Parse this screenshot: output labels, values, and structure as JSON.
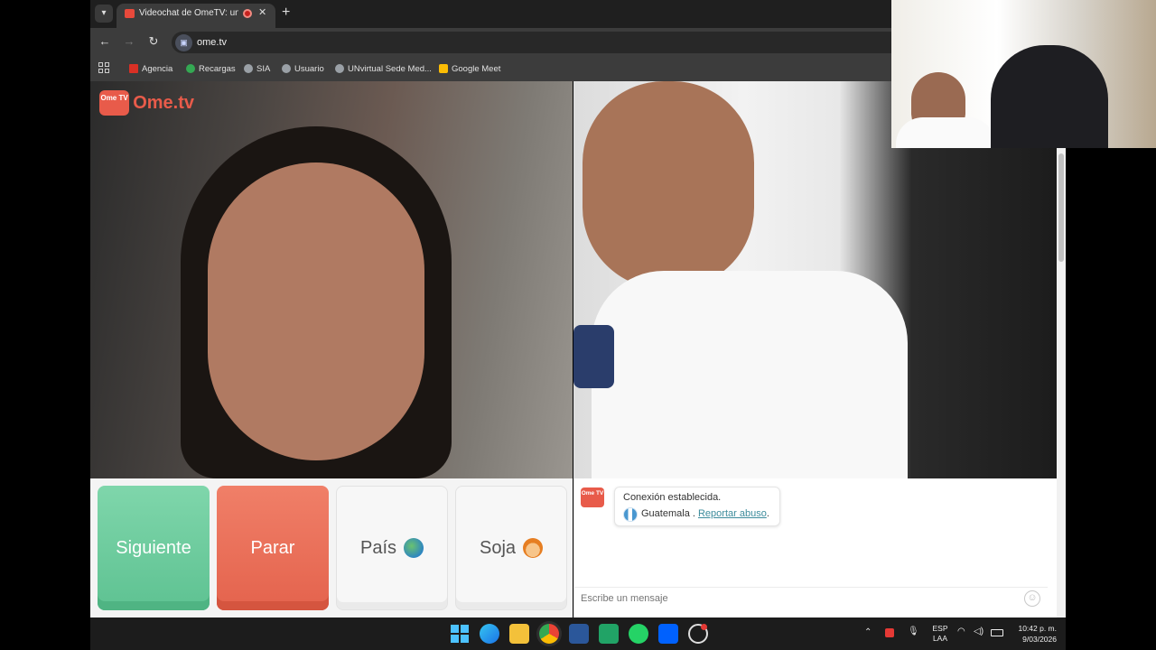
{
  "browser": {
    "tab_title": "Videochat de OmeTV: una ",
    "url": "ome.tv",
    "tab_close": "✕",
    "new_tab": "+",
    "bookmarks": [
      {
        "label": "Agencia",
        "icon": "gmail-icon",
        "color": "#d93025"
      },
      {
        "label": "Recargas",
        "icon": "recargas-icon",
        "color": "#34a853"
      },
      {
        "label": "SIA",
        "icon": "globe-icon",
        "color": "#9aa0a6"
      },
      {
        "label": "Usuario",
        "icon": "globe-icon",
        "color": "#9aa0a6"
      },
      {
        "label": "UNvirtual Sede Med...",
        "icon": "globe-icon",
        "color": "#9aa0a6"
      },
      {
        "label": "Google Meet",
        "icon": "meet-icon",
        "color": "#fbbc04"
      }
    ]
  },
  "app": {
    "logo_text": "Ome.tv",
    "logo_badge": "Ome TV",
    "accent_color": "#e85b4a"
  },
  "controls": {
    "next_label": "Siguiente",
    "stop_label": "Parar",
    "country_label": "País",
    "gender_label": "Soja"
  },
  "chat": {
    "status": "Conexión establecida.",
    "country": "Guatemala",
    "separator": " . ",
    "report_label": "Reportar abuso",
    "report_suffix": ".",
    "input_placeholder": "Escribe un mensaje"
  },
  "taskbar": {
    "lang_line1": "ESP",
    "lang_line2": "LAA",
    "time": "10:42 p. m.",
    "date": "9/03/2026"
  }
}
